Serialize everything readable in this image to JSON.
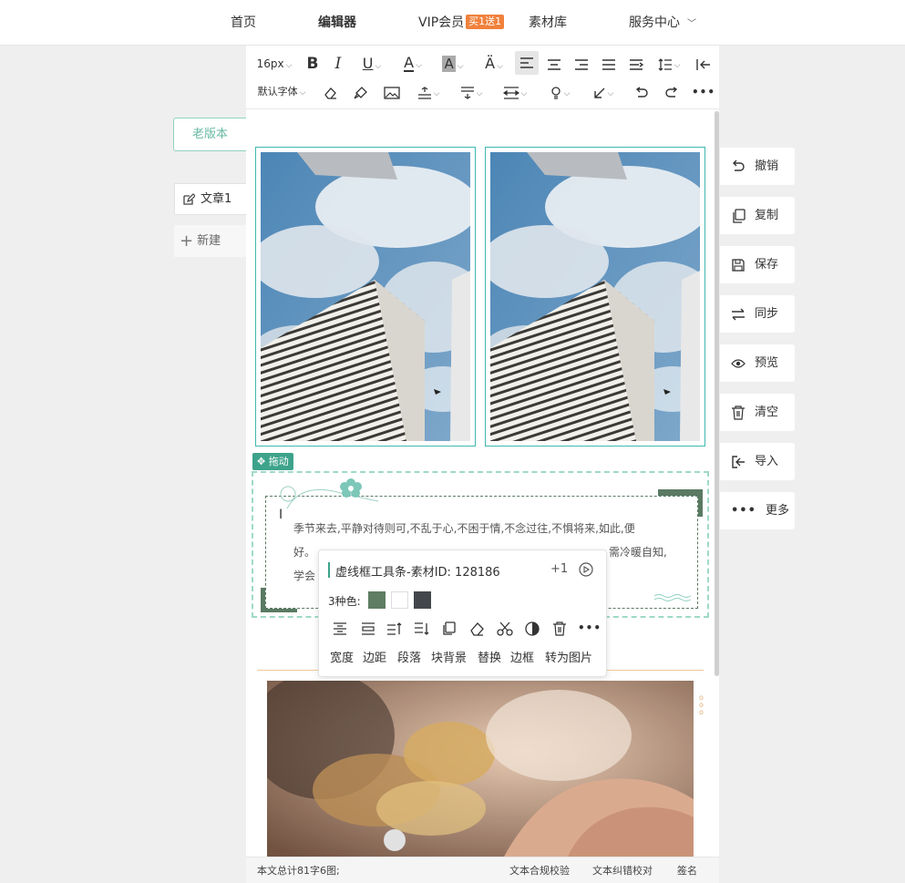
{
  "nav": {
    "home": "首页",
    "editor": "编辑器",
    "vip": "VIP会员",
    "vip_badge": "买1送1",
    "materials": "素材库",
    "service": "服务中心"
  },
  "toolbar": {
    "font_size": "16px",
    "font_family": "默认字体"
  },
  "left_panel": {
    "old_version": "老版本",
    "doc_name": "文章1",
    "new_label": "新建"
  },
  "side_actions": [
    {
      "label": "撤销",
      "icon": "undo-icon"
    },
    {
      "label": "复制",
      "icon": "copy-icon"
    },
    {
      "label": "保存",
      "icon": "save-icon"
    },
    {
      "label": "同步",
      "icon": "sync-icon"
    },
    {
      "label": "预览",
      "icon": "eye-icon"
    },
    {
      "label": "清空",
      "icon": "trash-icon"
    },
    {
      "label": "导入",
      "icon": "import-icon"
    },
    {
      "label": "更多",
      "icon": "more-icon"
    }
  ],
  "content": {
    "drag_label": "拖动",
    "paragraph_line1": "季节来去,平静对待则可,不乱于心,不困于情,不念过往,不惧将来,如此,便",
    "paragraph_line2_start": "好。",
    "paragraph_line2_end": "需冷暖自知,",
    "paragraph_line3_start": "学会"
  },
  "popup": {
    "title": "虚线框工具条-素材ID: 128186",
    "plus": "+1",
    "colors_label": "3种色:",
    "colors": [
      "#5e7d62",
      "#ffffff",
      "#43474b"
    ],
    "actions": [
      "宽度",
      "边距",
      "段落",
      "块背景",
      "替换",
      "边框",
      "转为图片"
    ]
  },
  "footer": {
    "stats": "本文总计81字6图;",
    "compliance": "文本合规校验",
    "proofread": "文本纠错校对",
    "signature": "签名"
  }
}
